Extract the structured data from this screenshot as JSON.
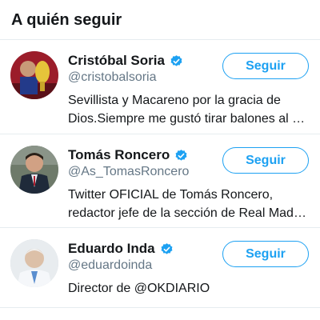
{
  "header": {
    "title": "A quién seguir"
  },
  "accent_color": "#1da1f2",
  "verified_icon": "verified-badge-icon",
  "users": [
    {
      "name": "Cristóbal Soria",
      "handle": "@cristobalsoria",
      "bio_lines": [
        "Sevillista y Macareno por la gracia de",
        "Dios.Siempre me gustó tirar balones al …"
      ],
      "follow_label": "Seguir",
      "verified": true
    },
    {
      "name": "Tomás Roncero",
      "handle": "@As_TomasRoncero",
      "bio_lines": [
        "Twitter OFICIAL de Tomás Roncero,",
        "redactor jefe de la sección de Real Mad…"
      ],
      "follow_label": "Seguir",
      "verified": true
    },
    {
      "name": "Eduardo Inda",
      "handle": "@eduardoinda",
      "bio_lines": [
        "Director de @OKDIARIO"
      ],
      "follow_label": "Seguir",
      "verified": true
    }
  ]
}
